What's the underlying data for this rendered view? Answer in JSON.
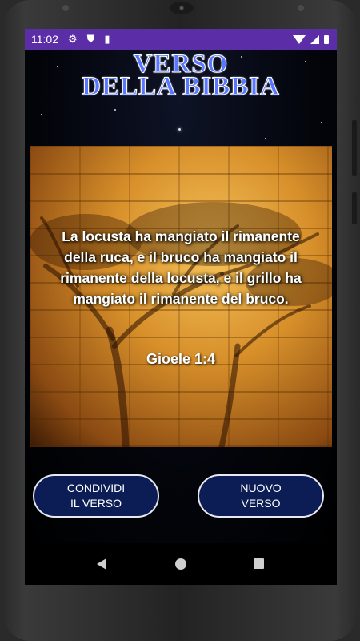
{
  "status_bar": {
    "time": "11:02",
    "icons": [
      "gear-icon",
      "shield-icon",
      "sd-card-icon",
      "wifi-icon",
      "signal-icon",
      "battery-icon"
    ],
    "background": "#5b2ea8"
  },
  "header": {
    "title_line1": "VERSO",
    "title_line2": "DELLA BIBBIA",
    "title_color": "#5a78ff"
  },
  "verse": {
    "text": "La locusta ha mangiato il rimanente della ruca, e il bruco ha mangiato il rimanente della locusta, e il grillo ha mangiato il rimanente del bruco.",
    "reference": "Gioele 1:4"
  },
  "buttons": {
    "share_label": "CONDIVIDI\nIL VERSO",
    "new_label": "NUOVO\nVERSO",
    "color": "#0c1d55"
  },
  "nav": {
    "icons": [
      "back-icon",
      "home-icon",
      "recents-icon"
    ]
  }
}
